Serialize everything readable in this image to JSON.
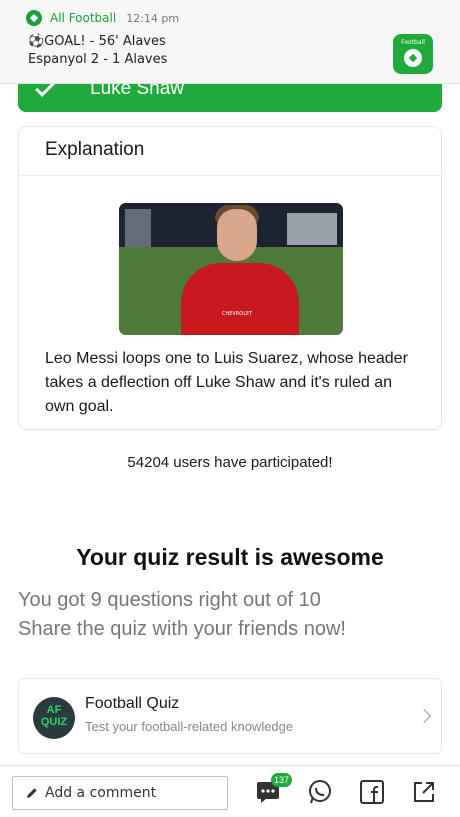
{
  "notification": {
    "app_name": "All Football",
    "time": "12:14 pm",
    "line1": "⚽GOAL! - 56' Alaves",
    "line2": "Espanyol 2 - 1 Alaves",
    "tile_text": "Football"
  },
  "answer": {
    "label": "Luke Shaw"
  },
  "explanation": {
    "title": "Explanation",
    "photo_sponsor": "CHEVROLET",
    "text": "Leo Messi loops one to Luis Suarez, whose header takes a deflection off Luke Shaw and it's ruled an own goal."
  },
  "participants": "54204 users have participated!",
  "result": {
    "title": "Your quiz result is awesome",
    "score_line": "You got 9 questions right out of 10",
    "share_line": "Share the quiz with your friends now!"
  },
  "quiz": {
    "logo_line1": "AF",
    "logo_line2": "QUIZ",
    "name": "Football Quiz",
    "description": "Test your football-related knowledge"
  },
  "bottom_bar": {
    "comment_placeholder": "Add a comment",
    "comment_count": "137",
    "icons": [
      "comments-icon",
      "whatsapp-icon",
      "facebook-icon",
      "share-icon"
    ]
  },
  "colors": {
    "brand_green": "#1faa3c",
    "muted_text": "#777777"
  }
}
